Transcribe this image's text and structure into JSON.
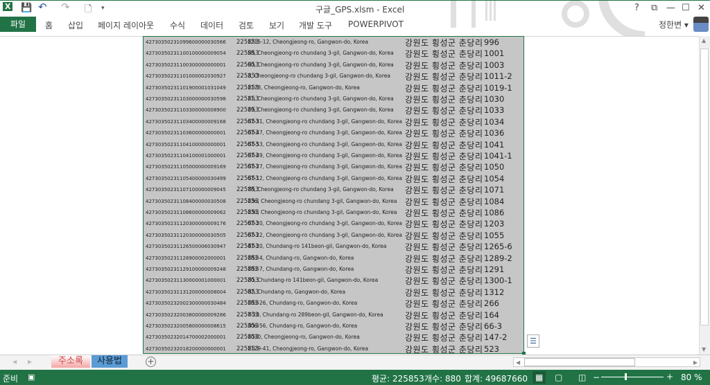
{
  "window": {
    "title": "구글_GPS.xlsm - Excel",
    "help": "?",
    "restore": "⧉",
    "minimize": "—",
    "maximize": "☐",
    "close": "✕"
  },
  "qat": {
    "excel_icon": "X",
    "save": "💾",
    "undo": "↶",
    "redo": "↷",
    "new": "🗋",
    "customize": "▾"
  },
  "ribbon": {
    "file": "파일",
    "tabs": [
      "홈",
      "삽입",
      "페이지 레이아웃",
      "수식",
      "데이터",
      "검토",
      "보기",
      "개발 도구",
      "POWERPIVOT"
    ],
    "user": "정한변 ▾"
  },
  "rows": [
    [
      "42730350231099600000030566",
      "225853",
      "1215-12, Cheongjeong-ro, Gangwon-do, Korea",
      "강원도 횡성군  춘당리",
      "996"
    ],
    [
      "42730350231100100000009054",
      "225853",
      "58, Cheongjeong-ro chundang 3-gil, Gangwon-do, Korea",
      "강원도 횡성군  춘당리",
      "1001"
    ],
    [
      "42730350231100300000000001",
      "225853",
      "60, Cheongjeong-ro chundang 3-gil, Gangwon-do, Korea",
      "강원도 횡성군  춘당리",
      "1003"
    ],
    [
      "42730350231101000002030927",
      "225853",
      "3, Cheongjeong-ro chundang 3-gil, Gangwon-do, Korea",
      "강원도 횡성군  춘당리",
      "1011-2"
    ],
    [
      "42730350231101900001031049",
      "225853",
      "1178, Cheongjeong-ro, Gangwon-do, Korea",
      "강원도 횡성군  춘당리",
      "1019-1"
    ],
    [
      "42730350231103000000030598",
      "225853",
      "11, Cheongjeong-ro chundang 3-gil, Gangwon-do, Korea",
      "강원도 횡성군  춘당리",
      "1030"
    ],
    [
      "42730350231103300000008900",
      "225853",
      "19, Cheongjeong-ro chundang 3-gil, Gangwon-do, Korea",
      "강원도 횡성군  춘당리",
      "1033"
    ],
    [
      "42730350231103400000009168",
      "225853",
      "67-31, Cheongjeong-ro chundang 3-gil, Gangwon-do, Korea",
      "강원도 횡성군  춘당리",
      "1034"
    ],
    [
      "42730350231103600000000001",
      "225853",
      "67-47, Cheongjeong-ro chundang 3-gil, Gangwon-do, Korea",
      "강원도 횡성군  춘당리",
      "1036"
    ],
    [
      "42730350231104100000000001",
      "225853",
      "67-53, Cheongjeong-ro chundang 3-gil, Gangwon-do, Korea",
      "강원도 횡성군  춘당리",
      "1041"
    ],
    [
      "42730350231104100001000001",
      "225853",
      "67-49, Cheongjeong-ro chundang 3-gil, Gangwon-do, Korea",
      "강원도 횡성군  춘당리",
      "1041-1"
    ],
    [
      "42730350231105000000009169",
      "225853",
      "67-27, Cheongjeong-ro chundang 3-gil, Gangwon-do, Korea",
      "강원도 횡성군  춘당리",
      "1050"
    ],
    [
      "42730350231105400000030499",
      "225853",
      "67-12, Cheongjeong-ro chundang 3-gil, Gangwon-do, Korea",
      "강원도 횡성군  춘당리",
      "1054"
    ],
    [
      "42730350231107100000009045",
      "225853",
      "78, Cheongjeong-ro chundang 3-gil, Gangwon-do, Korea",
      "강원도 횡성군  춘당리",
      "1071"
    ],
    [
      "42730350231108400000030508",
      "225853",
      "136, Cheongjeong-ro chundang 3-gil, Gangwon-do, Korea",
      "강원도 횡성군  춘당리",
      "1084"
    ],
    [
      "42730350231108600000009062",
      "225853",
      "130, Cheongjeong-ro chundang 3-gil, Gangwon-do, Korea",
      "강원도 횡성군  춘당리",
      "1086"
    ],
    [
      "42730350231120300000009176",
      "225853",
      "67-20, Cheongjeong-ro chundang 3-gil, Gangwon-do, Korea",
      "강원도 횡성군  춘당리",
      "1203"
    ],
    [
      "42730350231120300000030505",
      "225853",
      "67-22, Cheongjeong-ro chundang 3-gil, Gangwon-do, Korea",
      "강원도 횡성군  춘당리",
      "1055"
    ],
    [
      "42730350231126500006030947",
      "225853",
      "47-20, Chundang-ro 141beon-gil, Gangwon-do, Korea",
      "강원도 횡성군  춘당리",
      "1265-6"
    ],
    [
      "42730350231128900002000001",
      "225853",
      "183-4, Chundang-ro, Gangwon-do, Korea",
      "강원도 횡성군  춘당리",
      "1289-2"
    ],
    [
      "42730350231129100000009248",
      "225853",
      "183-7, Chundang-ro, Gangwon-do, Korea",
      "강원도 횡성군  춘당리",
      "1291"
    ],
    [
      "42730350231130000001000001",
      "225853",
      "20, Chundang-ro 141beon-gil, Gangwon-do, Korea",
      "강원도 횡성군  춘당리",
      "1300-1"
    ],
    [
      "42730350231131200000008004",
      "225853",
      "82, Chundang-ro, Gangwon-do, Korea",
      "강원도 횡성군  춘당리",
      "1312"
    ],
    [
      "42730350232002300000030484",
      "225853",
      "183-26, Chundang-ro, Gangwon-do, Korea",
      "강원도 횡성군  춘당리",
      "266"
    ],
    [
      "42730350232003800000009286",
      "225853",
      "7-20, Chundang-ro 289beon-gil, Gangwon-do, Korea",
      "강원도 횡성군  춘당리",
      "164"
    ],
    [
      "42730350232005800000008615",
      "225853",
      "306-56, Chundang-ro, Gangwon-do, Korea",
      "강원도 횡성군  춘당리",
      "66-3"
    ],
    [
      "42730350232014700002000001",
      "225853",
      "1030, Cheongjeong-ro, Gangwon-do, Korea",
      "강원도 횡성군  춘당리",
      "147-2"
    ],
    [
      "42730350232018200000000001",
      "225853",
      "1129-41, Cheongjeong-ro, Gangwon-do, Korea",
      "강원도 횡성군  춘당리",
      "523"
    ]
  ],
  "sheets": {
    "tabs": [
      "주소록",
      "사용법"
    ],
    "add": "+",
    "prev": "◀",
    "next": "▶"
  },
  "status": {
    "ready": "준비",
    "average": "평균: 225853",
    "count": "개수: 880",
    "sum": "합계: 49687660",
    "zoom_minus": "−",
    "zoom_plus": "+",
    "zoom": "80 %",
    "zoom_level": 80
  },
  "colors": {
    "accent": "#217346",
    "selection": "#c6c6c6"
  }
}
